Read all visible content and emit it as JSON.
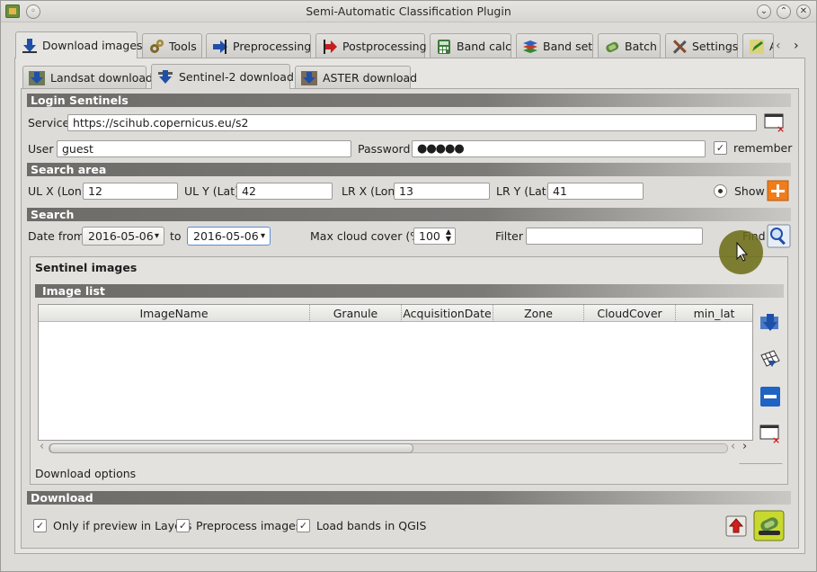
{
  "window": {
    "title": "Semi-Automatic Classification Plugin"
  },
  "main_tabs": [
    {
      "label": "Download images"
    },
    {
      "label": "Tools"
    },
    {
      "label": "Preprocessing"
    },
    {
      "label": "Postprocessing"
    },
    {
      "label": "Band calc"
    },
    {
      "label": "Band set"
    },
    {
      "label": "Batch"
    },
    {
      "label": "Settings"
    },
    {
      "label": "A"
    }
  ],
  "sub_tabs": [
    {
      "label": "Landsat download"
    },
    {
      "label": "Sentinel-2 download"
    },
    {
      "label": "ASTER download"
    }
  ],
  "login": {
    "header": "Login Sentinels",
    "service_label": "Service",
    "service_value": "https://scihub.copernicus.eu/s2",
    "user_label": "User",
    "user_value": "guest",
    "password_label": "Password",
    "password_value": "●●●●●",
    "remember_label": "remember",
    "remember_checked": true
  },
  "search_area": {
    "header": "Search area",
    "ul_x_label": "UL X (Lon)",
    "ul_x_value": "12",
    "ul_y_label": "UL Y (Lat)",
    "ul_y_value": "42",
    "lr_x_label": "LR X (Lon)",
    "lr_x_value": "13",
    "lr_y_label": "LR Y (Lat)",
    "lr_y_value": "41",
    "show_label": "Show"
  },
  "search": {
    "header": "Search",
    "date_from_label": "Date from",
    "date_from_value": "2016-05-06",
    "to_label": "to",
    "date_to_value": "2016-05-06",
    "max_cloud_label": "Max cloud cover (%)",
    "max_cloud_value": "100",
    "filter_label": "Filter",
    "filter_value": "",
    "find_label": "Find"
  },
  "sentinel_images": {
    "title": "Sentinel images",
    "image_list_header": "Image list",
    "columns": [
      "ImageName",
      "Granule",
      "AcquisitionDate",
      "Zone",
      "CloudCover",
      "min_lat"
    ],
    "rows": [],
    "download_options_label": "Download options"
  },
  "download": {
    "header": "Download",
    "only_preview_label": "Only if preview in Layers",
    "preprocess_label": "Preprocess images",
    "load_bands_label": "Load bands in QGIS"
  },
  "colors": {
    "section_header": "#6d6c69",
    "accent_orange": "#f07d1a",
    "accent_blue": "#1f63c4",
    "cursor": "#6b6b14"
  }
}
